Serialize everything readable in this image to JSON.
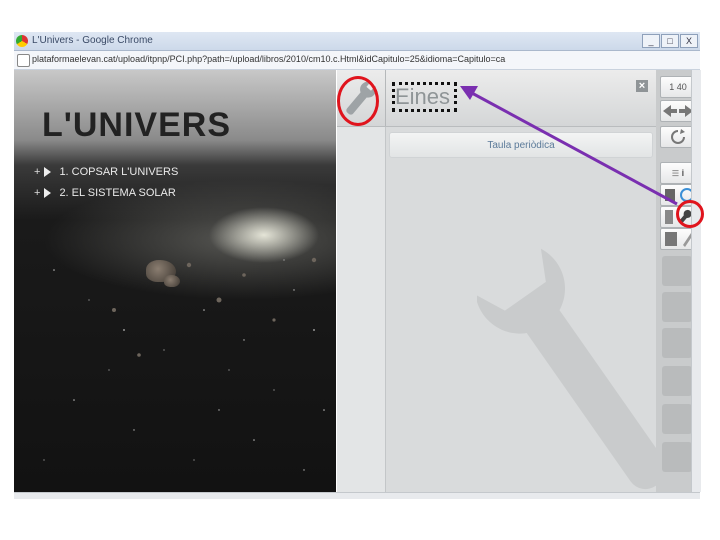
{
  "window": {
    "title": "L'Univers - Google Chrome",
    "controls": [
      "_",
      "□",
      "X"
    ]
  },
  "address_bar": {
    "url": "plataformaelevan.cat/upload/itpnp/PCI.php?path=/upload/libros/2010/cm10.c.Html&idCapitulo=25&idioma=Capitulo=ca"
  },
  "left_panel": {
    "title": "L'UNIVERS",
    "menu": [
      {
        "plus": "+",
        "label": "1. COPSAR L'UNIVERS"
      },
      {
        "plus": "+",
        "label": "2. EL SISTEMA SOLAR"
      }
    ]
  },
  "tools_panel": {
    "title": "Eines",
    "close_label": "×",
    "items": [
      {
        "label": "Taula periòdica"
      }
    ]
  },
  "right_toolbar": {
    "page_label": "1 40",
    "index_label": "i",
    "accent": "#e0141d",
    "annotation_arrow_color": "#7a2fb0"
  }
}
